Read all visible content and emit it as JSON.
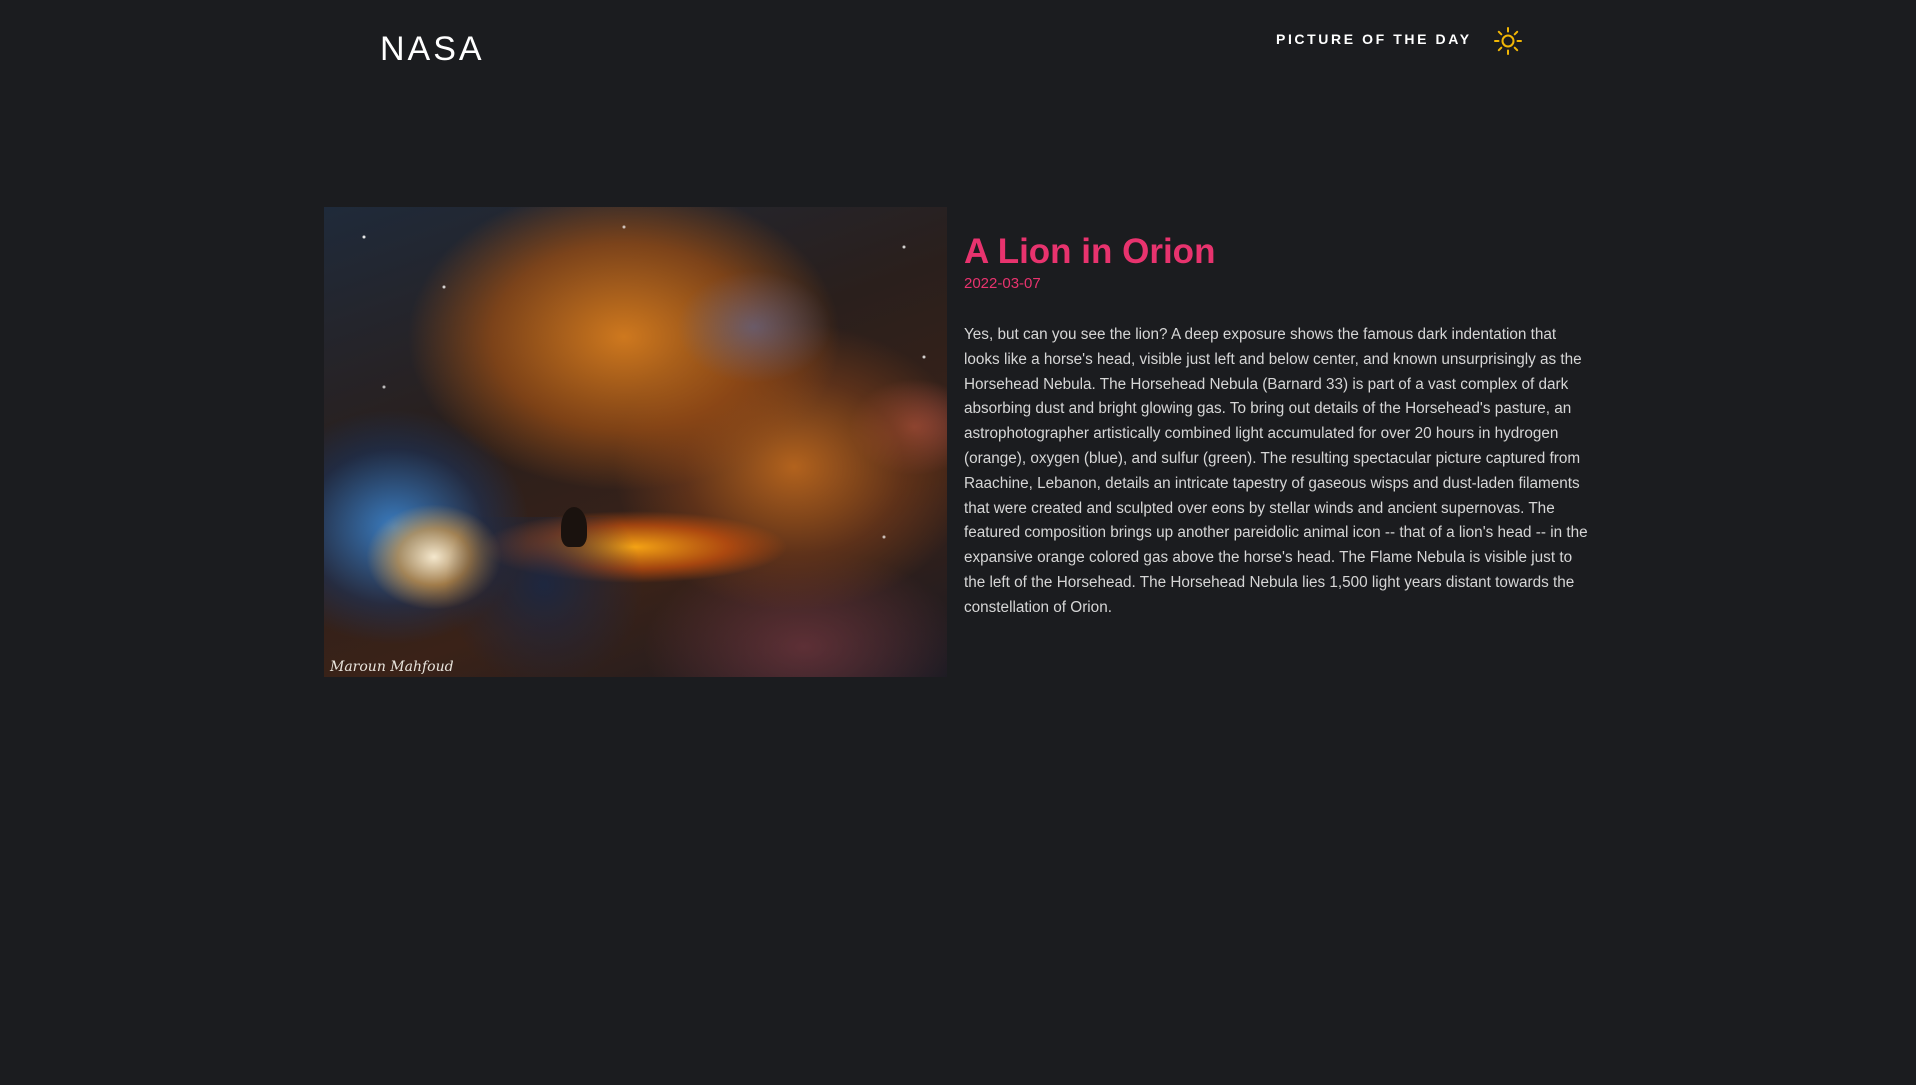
{
  "header": {
    "brand": "NASA",
    "nav_label": "PICTURE OF THE DAY",
    "theme_icon": "sun-icon",
    "accent_color": "#f2b705"
  },
  "apod": {
    "title": "A Lion in Orion",
    "date": "2022-03-07",
    "explanation": "Yes, but can you see the lion? A deep exposure shows the famous dark indentation that looks like a horse's head, visible just left and below center, and known unsurprisingly as the Horsehead Nebula. The Horsehead Nebula (Barnard 33) is part of a vast complex of dark absorbing dust and bright glowing gas. To bring out details of the Horsehead's pasture, an astrophotographer artistically combined light accumulated for over 20 hours in hydrogen (orange), oxygen (blue), and sulfur (green). The resulting spectacular picture captured from Raachine, Lebanon, details an intricate tapestry of gaseous wisps and dust-laden filaments that were created and sculpted over eons by stellar winds and ancient supernovas. The featured composition brings up another pareidolic animal icon -- that of a lion's head -- in the expansive orange colored gas above the horse's head. The Flame Nebula is visible just to the left of the Horsehead. The Horsehead Nebula lies 1,500 light years distant towards the constellation of Orion.",
    "image_credit": "Maroun Mahfoud",
    "title_color": "#e8336e"
  }
}
